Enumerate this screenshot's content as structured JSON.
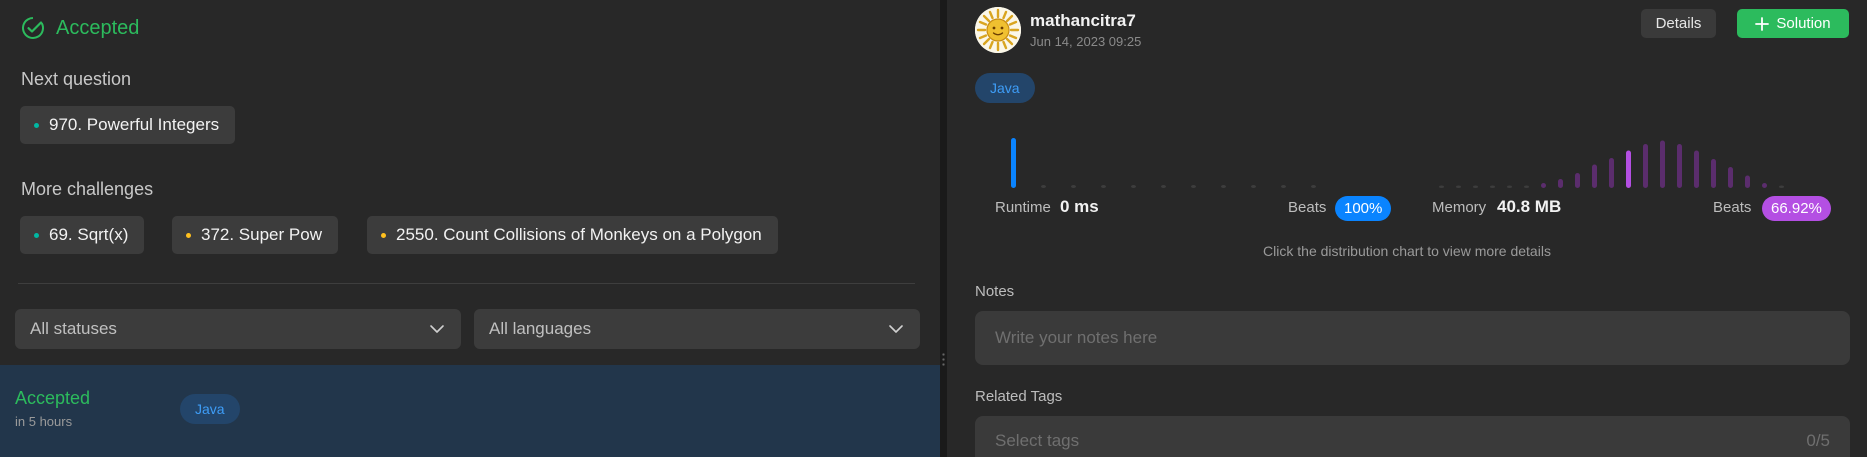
{
  "result": {
    "status": "Accepted"
  },
  "next_question": {
    "label": "Next question",
    "item": {
      "title": "970. Powerful Integers",
      "difficulty": "easy"
    }
  },
  "more_challenges": {
    "label": "More challenges",
    "items": [
      {
        "title": "69. Sqrt(x)",
        "difficulty": "easy"
      },
      {
        "title": "372. Super Pow",
        "difficulty": "medium"
      },
      {
        "title": "2550. Count Collisions of Monkeys on a Polygon",
        "difficulty": "medium"
      }
    ]
  },
  "filters": {
    "status": "All statuses",
    "language": "All languages"
  },
  "submissions": [
    {
      "status": "Accepted",
      "time": "in 5 hours",
      "language": "Java"
    }
  ],
  "detail": {
    "username": "mathancitra7",
    "date": "Jun 14, 2023 09:25",
    "details_button": "Details",
    "solution_button": "Solution",
    "language": "Java",
    "runtime": {
      "label": "Runtime",
      "value": "0 ms",
      "beats_label": "Beats",
      "beats": "100%"
    },
    "memory": {
      "label": "Memory",
      "value": "40.8 MB",
      "beats_label": "Beats",
      "beats": "66.92%"
    },
    "hint": "Click the distribution chart to view more details",
    "notes_label": "Notes",
    "notes_placeholder": "Write your notes here",
    "tags_label": "Related Tags",
    "tags_placeholder": "Select tags",
    "tags_count": "0/5"
  },
  "chart_data": [
    {
      "type": "bar",
      "series": [
        {
          "values": [
            1.0,
            0.06,
            0.06,
            0.06,
            0.06,
            0.06,
            0.06,
            0.06,
            0.06,
            0.06,
            0.06
          ]
        }
      ],
      "highlight_index": 0,
      "colors": {
        "bar": "#0a84ff",
        "highlight": "#0a84ff"
      }
    },
    {
      "type": "bar",
      "series": [
        {
          "values": [
            0.05,
            0.05,
            0.05,
            0.05,
            0.05,
            0.05,
            0.1,
            0.18,
            0.3,
            0.47,
            0.6,
            0.75,
            0.88,
            0.95,
            0.88,
            0.75,
            0.58,
            0.42,
            0.25,
            0.1,
            0.05
          ]
        }
      ],
      "highlight_index": 11,
      "colors": {
        "bar": "#5b2d6d",
        "highlight": "#b44fe3"
      }
    }
  ],
  "colors": {
    "accepted": "#2cbb5d",
    "runtime_beats": "#0a84ff",
    "memory_beats": "#b44fe3",
    "easy": "#00b8a3",
    "medium": "#ffc01e"
  }
}
